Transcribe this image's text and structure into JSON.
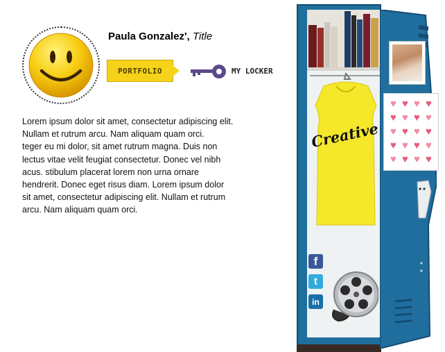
{
  "profile": {
    "name": "Paula Gonzalez',",
    "title": "Title",
    "avatar_icon": "smiley-face-icon"
  },
  "nav": {
    "portfolio_label": "PORTFOLIO",
    "locker_label": "MY LOCKER",
    "key_icon": "key-icon"
  },
  "bio": {
    "text": "Lorem ipsum dolor sit amet, consectetur adipiscing elit.\nNullam et rutrum arcu. Nam aliquam quam orci.\nteger eu mi dolor, sit amet rutrum magna. Duis non\nlectus vitae velit feugiat consectetur. Donec vel nibh\nacus. stibulum placerat lorem non urna ornare\n hendrerit. Donec eget risus diam. Lorem ipsum dolor\nsit amet, consectetur adipiscing elit. Nullam et rutrum\narcu. Nam aliquam quam orci."
  },
  "locker": {
    "shirt_text": "Creative",
    "social": [
      "facebook-icon",
      "twitter-icon",
      "linkedin-icon"
    ],
    "film_icon": "film-reel-icon",
    "colors": {
      "locker_blue": "#1f6e9e",
      "portfolio_yellow": "#f6d21a",
      "key_purple": "#5b4a8c"
    }
  }
}
